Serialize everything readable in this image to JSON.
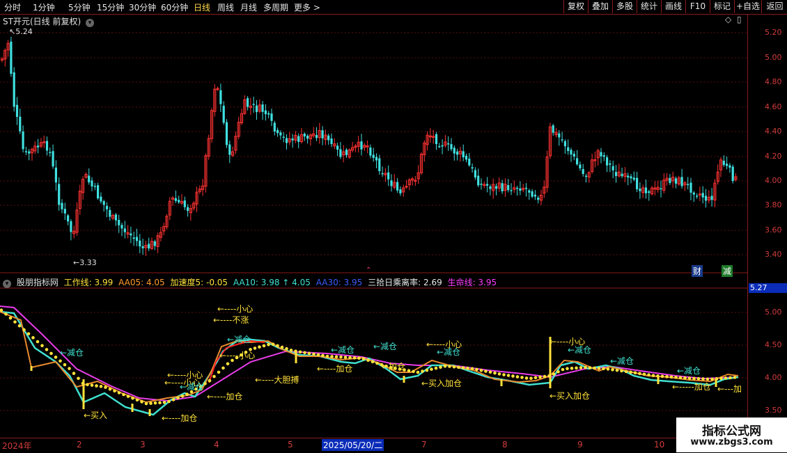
{
  "toolbar": {
    "timeframes": [
      "分时",
      "1分钟",
      "5分钟",
      "15分钟",
      "30分钟",
      "60分钟",
      "日线",
      "周线",
      "月线",
      "多周期",
      "更多 >"
    ],
    "active_index": 6,
    "buttons": [
      "复权",
      "叠加",
      "多股",
      "统计",
      "画线",
      "F10",
      "标记",
      "+自选",
      "返回"
    ]
  },
  "chart_title": "ST开元(日线 前复权)",
  "price_axis": [
    "5.20",
    "5.00",
    "4.80",
    "4.60",
    "4.40",
    "4.20",
    "4.00",
    "3.80",
    "3.60",
    "3.40"
  ],
  "markers": {
    "high": "5.24",
    "low": "3.33"
  },
  "badges": {
    "cai": "财",
    "jian": "减"
  },
  "indicator": {
    "name": "股朋指标网",
    "items": [
      {
        "label": "工作线: 3.99",
        "color": "#ffe23a"
      },
      {
        "label": "AA05: 4.05",
        "color": "#ff9a2e"
      },
      {
        "label": "加速度5: -0.05",
        "color": "#ffe23a"
      },
      {
        "label": "AA10: 3.98 ↑ 4.05",
        "color": "#40e0d0"
      },
      {
        "label": "AA30: 3.95",
        "color": "#3a5cff"
      },
      {
        "label": "三拾日乘离率: 2.69",
        "color": "#e8e8e8"
      },
      {
        "label": "生命线: 3.95",
        "color": "#ff3cff"
      }
    ],
    "current_value": "5.27",
    "axis": [
      "5.00",
      "4.50",
      "4.00",
      "3.50"
    ]
  },
  "annotations": [
    {
      "text": "←减仓",
      "color": "#40e0d0"
    },
    {
      "text": "←买入",
      "color": "#ffe23a"
    },
    {
      "text": "←----加仓",
      "color": "#ffe23a"
    },
    {
      "text": "←----小心",
      "color": "#ffe23a"
    },
    {
      "text": "←----小心",
      "color": "#ffe23a"
    },
    {
      "text": "←减仓",
      "color": "#40e0d0"
    },
    {
      "text": "←----加仓",
      "color": "#ffe23a"
    },
    {
      "text": "←----小心",
      "color": "#ffe23a"
    },
    {
      "text": "←----不涨",
      "color": "#ffe23a"
    },
    {
      "text": "←减仓",
      "color": "#40e0d0"
    },
    {
      "text": "←----小心",
      "color": "#ffe23a"
    },
    {
      "text": "←----大胆搏",
      "color": "#ffe23a"
    },
    {
      "text": "←----加仓",
      "color": "#ffe23a"
    },
    {
      "text": "←减仓",
      "color": "#40e0d0"
    },
    {
      "text": "←减仓",
      "color": "#40e0d0"
    },
    {
      "text": "←加仓",
      "color": "#ffe23a"
    },
    {
      "text": "←----小心",
      "color": "#ffe23a"
    },
    {
      "text": "←减仓",
      "color": "#40e0d0"
    },
    {
      "text": "←买入加仓",
      "color": "#ffe23a"
    },
    {
      "text": "←----小心",
      "color": "#ffe23a"
    },
    {
      "text": "←减仓",
      "color": "#40e0d0"
    },
    {
      "text": "←买入加仓",
      "color": "#ffe23a"
    },
    {
      "text": "←减仓",
      "color": "#40e0d0"
    },
    {
      "text": "←减仓",
      "color": "#40e0d0"
    },
    {
      "text": "←-----加仓",
      "color": "#ffe23a"
    },
    {
      "text": "←---加",
      "color": "#ffe23a"
    }
  ],
  "date_axis": [
    "2024年",
    "2",
    "3",
    "4",
    "5",
    "7",
    "8",
    "9",
    "10"
  ],
  "selected_date": "2025/05/20/二",
  "watermark": {
    "line1": "指标公式网",
    "line2": "www.zbgs3.com"
  },
  "colors": {
    "up": "#ff3232",
    "down": "#40e0e0",
    "grid": "#8b1a1a"
  }
}
